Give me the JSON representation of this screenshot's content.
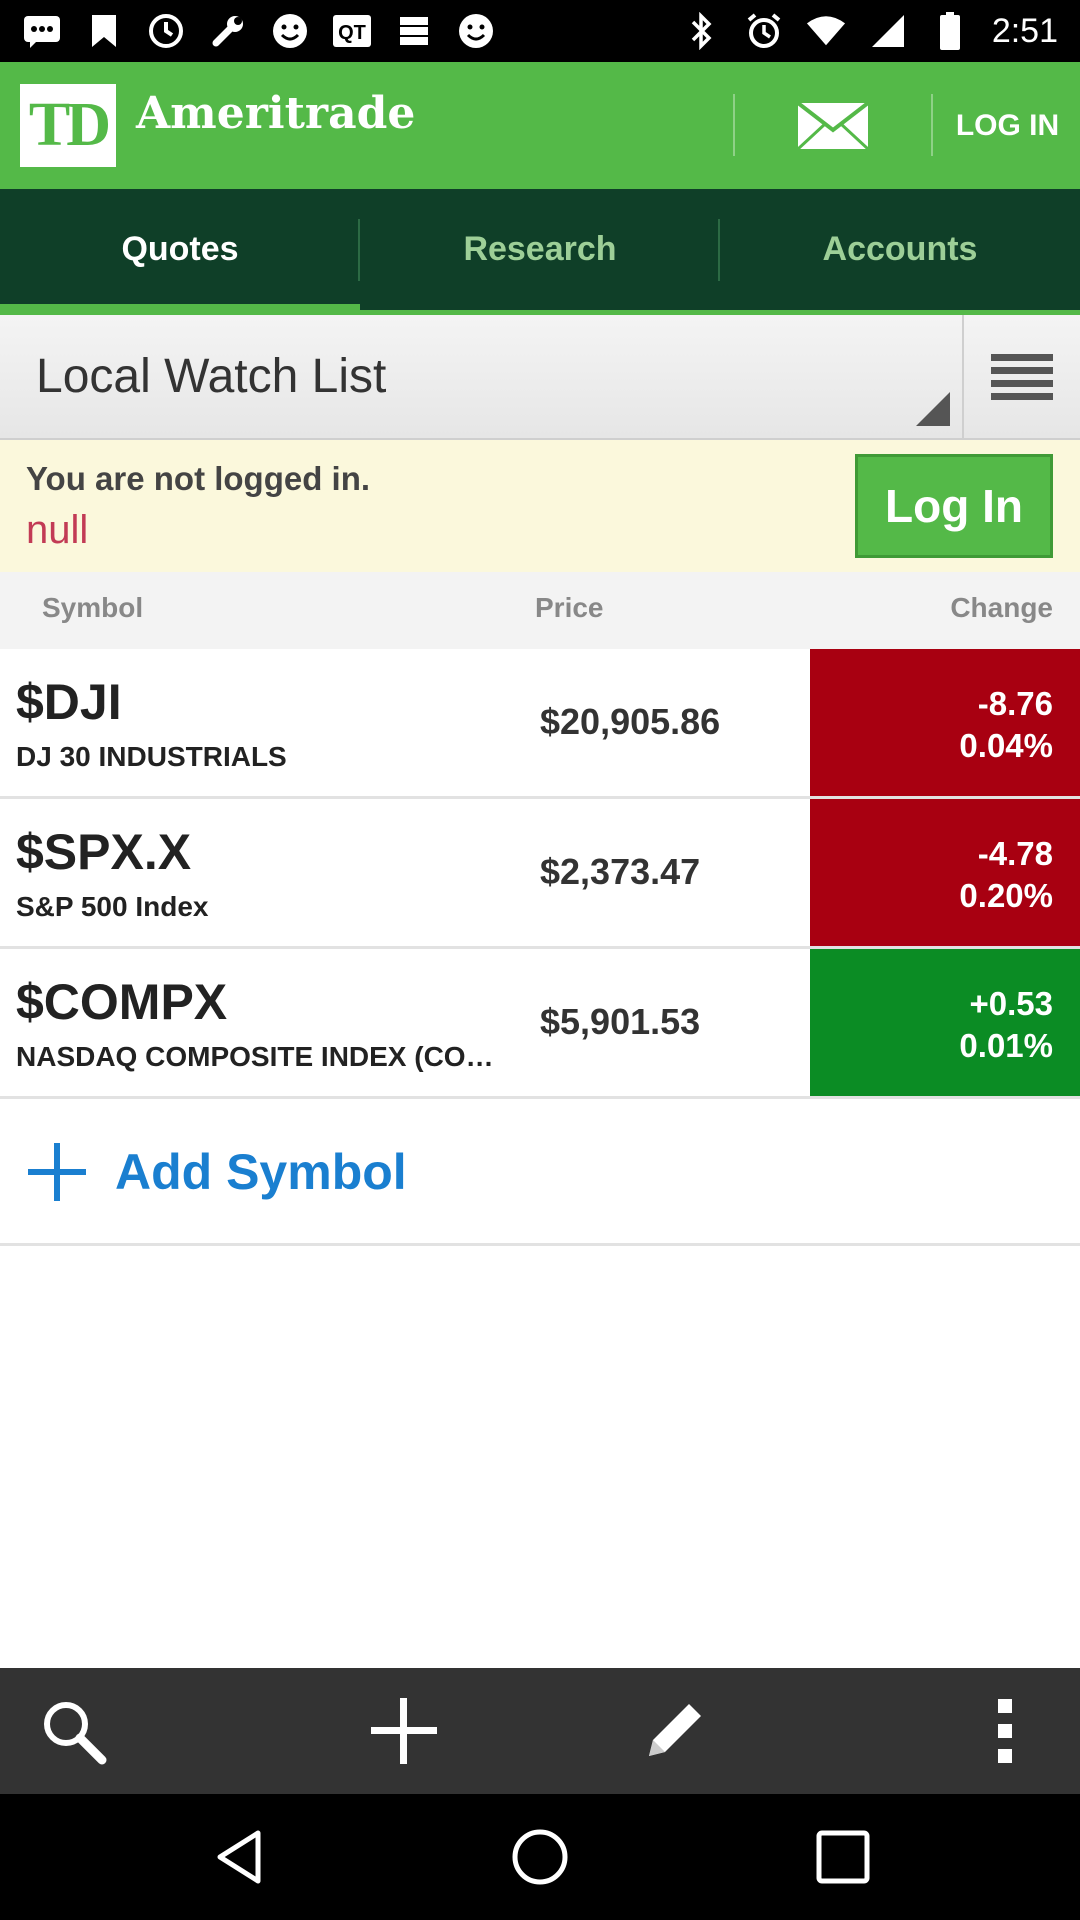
{
  "status_bar": {
    "time": "2:51",
    "icons": [
      "messages-icon",
      "bookmark-icon",
      "clock-icon",
      "wrench-icon",
      "smiley-icon",
      "qt-app-icon",
      "server-icon",
      "smiley-icon",
      "bluetooth-icon",
      "alarm-icon",
      "wifi-icon",
      "signal-icon",
      "battery-icon"
    ]
  },
  "header": {
    "logo_text": "TD",
    "brand": "Ameritrade",
    "login_label": "LOG IN",
    "brand_color": "#54b948"
  },
  "tabs": [
    {
      "label": "Quotes",
      "active": true
    },
    {
      "label": "Research",
      "active": false
    },
    {
      "label": "Accounts",
      "active": false
    }
  ],
  "watchlist": {
    "title": "Local Watch List"
  },
  "notice": {
    "message": "You are not logged in.",
    "sub": "null",
    "button": "Log In"
  },
  "columns": {
    "symbol": "Symbol",
    "price": "Price",
    "change": "Change"
  },
  "quotes": [
    {
      "symbol": "$DJI",
      "name": "DJ 30 INDUSTRIALS",
      "price": "$20,905.86",
      "change": "-8.76",
      "change_pct": "0.04%",
      "direction": "down"
    },
    {
      "symbol": "$SPX.X",
      "name": "S&P 500 Index",
      "price": "$2,373.47",
      "change": "-4.78",
      "change_pct": "0.20%",
      "direction": "down"
    },
    {
      "symbol": "$COMPX",
      "name": "NASDAQ COMPOSITE INDEX (COMP)",
      "price": "$5,901.53",
      "change": "+0.53",
      "change_pct": "0.01%",
      "direction": "up"
    }
  ],
  "add_symbol": {
    "label": "Add Symbol"
  },
  "action_bar": [
    "search-icon",
    "plus-icon",
    "pencil-icon",
    "overflow-menu-icon"
  ],
  "nav_bar": [
    "back-icon",
    "home-icon",
    "recents-icon"
  ],
  "colors": {
    "down": "#a80011",
    "up": "#0b8c24",
    "link": "#1a7fd0"
  }
}
